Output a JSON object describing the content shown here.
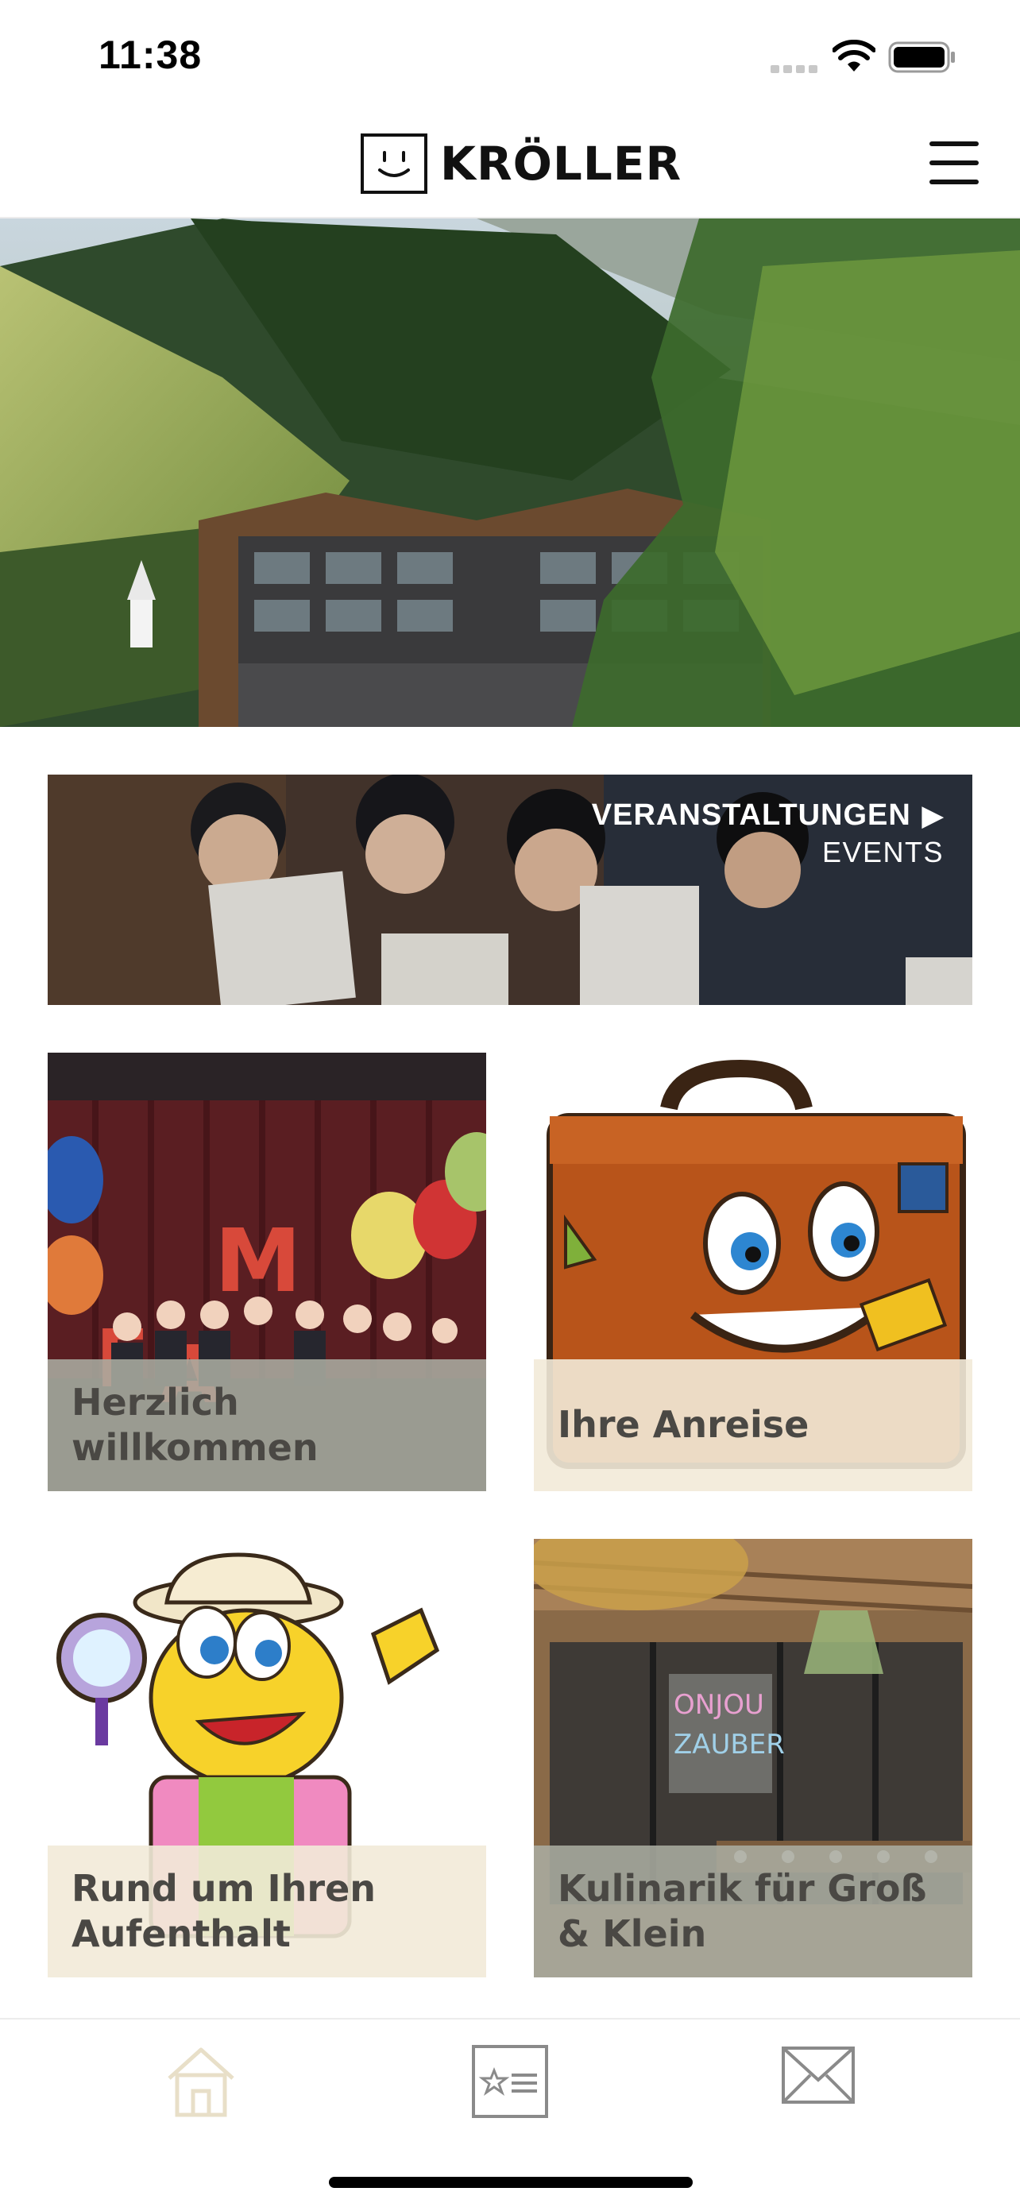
{
  "status": {
    "time": "11:38"
  },
  "header": {
    "logo_text": "KRÖLLER",
    "menu_icon": "hamburger-menu-icon"
  },
  "hero": {
    "alt": ""
  },
  "events": {
    "title": "VERANSTALTUNGEN",
    "subtitle": "EVENTS"
  },
  "tiles": [
    {
      "label": "Herzlich willkommen"
    },
    {
      "label": "Ihre Anreise"
    },
    {
      "label": "Rund um Ihren Aufenthalt"
    },
    {
      "label": "Kulinarik für Groß & Klein"
    }
  ],
  "tabbar": {
    "items": [
      "home-icon",
      "bulletin-icon",
      "mail-icon"
    ]
  },
  "colors": {
    "caption_grey": "#aaac a0",
    "caption_cream": "#f2ead8",
    "accent_tab": "#e8dfc8"
  }
}
